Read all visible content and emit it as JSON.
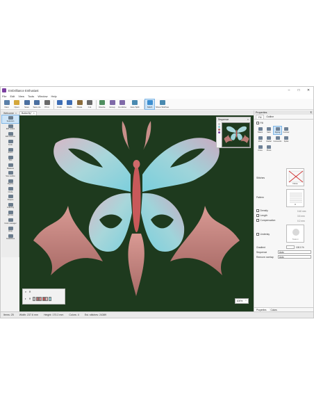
{
  "window": {
    "title": "Embrilliance Enthusiast"
  },
  "menu": [
    "File",
    "Edit",
    "View",
    "Tools",
    "Window",
    "Help"
  ],
  "ribbon": [
    {
      "label": "New",
      "icon": "new-file-icon",
      "color": "#5a7fa8"
    },
    {
      "label": "Open",
      "icon": "open-folder-icon",
      "color": "#d4a73a"
    },
    {
      "label": "Save",
      "icon": "save-icon",
      "color": "#4b6fa0"
    },
    {
      "label": "Save As",
      "icon": "save-as-icon",
      "color": "#4b6fa0"
    },
    {
      "label": "Print",
      "icon": "print-icon",
      "color": "#6a6a6a"
    },
    {
      "label": "Undo",
      "icon": "undo-icon",
      "color": "#3d6db5"
    },
    {
      "label": "Redo",
      "icon": "redo-icon",
      "color": "#3d6db5"
    },
    {
      "label": "Paste",
      "icon": "paste-icon",
      "color": "#8a6b3a"
    },
    {
      "label": "Cut",
      "icon": "cut-icon",
      "color": "#6a6a6a"
    },
    {
      "label": "Resize",
      "icon": "resize-icon",
      "color": "#4f8f5f"
    },
    {
      "label": "Group",
      "icon": "group-icon",
      "color": "#7f6aa8"
    },
    {
      "label": "Combine",
      "icon": "combine-icon",
      "color": "#7f6aa8"
    },
    {
      "label": "Auto Split",
      "icon": "split-icon",
      "color": "#4a8ab0"
    },
    {
      "label": "Stitch",
      "icon": "stitch-icon",
      "color": "#3e8fd0",
      "active": true
    },
    {
      "label": "Show Stitches",
      "icon": "show-stitches-icon",
      "color": "#4a8ab0"
    }
  ],
  "doc_tabs": [
    {
      "label": "Welcome",
      "active": false
    },
    {
      "label": "Butterfly*",
      "active": true
    }
  ],
  "tools": [
    {
      "label": "Selection",
      "active": true
    },
    {
      "label": "Edit nodes"
    },
    {
      "label": "Edit stitches"
    },
    {
      "label": "Knife"
    },
    {
      "label": "Zoom"
    },
    {
      "label": "Pan"
    },
    {
      "label": "Measure"
    },
    {
      "label": "Sew outline"
    },
    {
      "label": "Digitize"
    },
    {
      "label": "Circle"
    },
    {
      "label": "Shapes"
    },
    {
      "label": "Lettering"
    },
    {
      "label": "Arrows"
    },
    {
      "label": "Color manager"
    },
    {
      "label": "Hoop"
    },
    {
      "label": "Guidelines"
    }
  ],
  "sequence": {
    "title": "Sequence"
  },
  "zoom": {
    "level": "100%"
  },
  "palette": {
    "colors": [
      "#c6c6c6",
      "#b56a6a",
      "#d88a8a",
      "#c24f4f",
      "#e3b0b0",
      "#8fd2da"
    ]
  },
  "properties": {
    "title": "Properties",
    "tabs": [
      {
        "label": "Fill",
        "active": true
      },
      {
        "label": "Outline"
      }
    ],
    "fill_label": "Fill",
    "sub_options": [
      {
        "label": "Tatami"
      },
      {
        "label": "Satin"
      },
      {
        "label": "Zigzag"
      },
      {
        "label": "Contour"
      }
    ],
    "row2": [
      {
        "label": "Motif"
      },
      {
        "label": "Radial"
      },
      {
        "label": "Concentric"
      },
      {
        "label": "Spiral"
      }
    ],
    "row3": [
      {
        "label": "Cross"
      },
      {
        "label": "Photo"
      }
    ],
    "stitches_label": "Stitches",
    "stitch_value": "None",
    "pattern_label": "Pattern",
    "pattern_value": "0",
    "density_label": "Density",
    "length_label": "Length",
    "compensation_label": "Compensation",
    "density_value": "0.40 mm",
    "length_value": "3.5 mm",
    "compensation_value": "0.2 mm",
    "underlay_label": "Underlay",
    "underlay_value": "Tatami",
    "gradient_label": "Gradient",
    "gradient_value": "100.0 %",
    "sequence_label": "Sequence",
    "sequence_value": "Auto",
    "remove_overlap_label": "Remove overlap",
    "remove_overlap_value": "Auto",
    "bottom_tabs": [
      {
        "label": "Properties",
        "active": true
      },
      {
        "label": "Colors"
      }
    ]
  },
  "status": {
    "items": "Items: 25",
    "width": "Width: 237.6 mm",
    "height": "Height: 170.2 mm",
    "colors": "Colors: 4",
    "stitches": "Est. stitches: 24389"
  }
}
